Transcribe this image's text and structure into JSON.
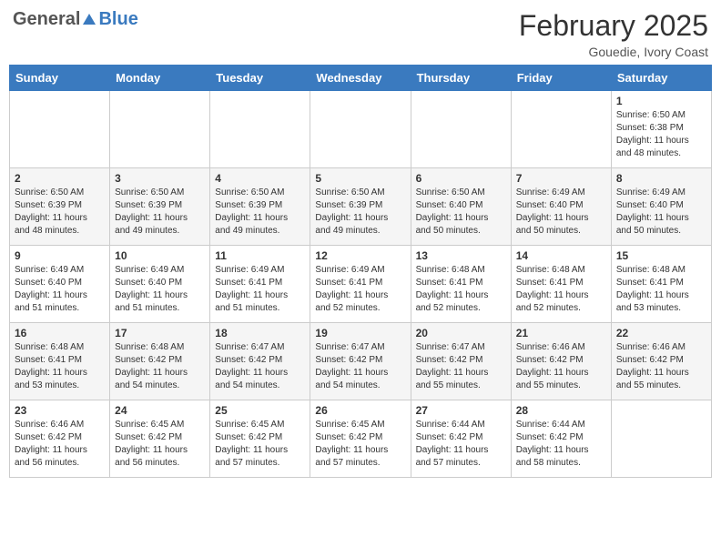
{
  "header": {
    "logo": {
      "text1": "General",
      "text2": "Blue"
    },
    "title": "February 2025",
    "subtitle": "Gouedie, Ivory Coast"
  },
  "days_of_week": [
    "Sunday",
    "Monday",
    "Tuesday",
    "Wednesday",
    "Thursday",
    "Friday",
    "Saturday"
  ],
  "weeks": [
    [
      {
        "day": "",
        "info": ""
      },
      {
        "day": "",
        "info": ""
      },
      {
        "day": "",
        "info": ""
      },
      {
        "day": "",
        "info": ""
      },
      {
        "day": "",
        "info": ""
      },
      {
        "day": "",
        "info": ""
      },
      {
        "day": "1",
        "info": "Sunrise: 6:50 AM\nSunset: 6:38 PM\nDaylight: 11 hours\nand 48 minutes."
      }
    ],
    [
      {
        "day": "2",
        "info": "Sunrise: 6:50 AM\nSunset: 6:39 PM\nDaylight: 11 hours\nand 48 minutes."
      },
      {
        "day": "3",
        "info": "Sunrise: 6:50 AM\nSunset: 6:39 PM\nDaylight: 11 hours\nand 49 minutes."
      },
      {
        "day": "4",
        "info": "Sunrise: 6:50 AM\nSunset: 6:39 PM\nDaylight: 11 hours\nand 49 minutes."
      },
      {
        "day": "5",
        "info": "Sunrise: 6:50 AM\nSunset: 6:39 PM\nDaylight: 11 hours\nand 49 minutes."
      },
      {
        "day": "6",
        "info": "Sunrise: 6:50 AM\nSunset: 6:40 PM\nDaylight: 11 hours\nand 50 minutes."
      },
      {
        "day": "7",
        "info": "Sunrise: 6:49 AM\nSunset: 6:40 PM\nDaylight: 11 hours\nand 50 minutes."
      },
      {
        "day": "8",
        "info": "Sunrise: 6:49 AM\nSunset: 6:40 PM\nDaylight: 11 hours\nand 50 minutes."
      }
    ],
    [
      {
        "day": "9",
        "info": "Sunrise: 6:49 AM\nSunset: 6:40 PM\nDaylight: 11 hours\nand 51 minutes."
      },
      {
        "day": "10",
        "info": "Sunrise: 6:49 AM\nSunset: 6:40 PM\nDaylight: 11 hours\nand 51 minutes."
      },
      {
        "day": "11",
        "info": "Sunrise: 6:49 AM\nSunset: 6:41 PM\nDaylight: 11 hours\nand 51 minutes."
      },
      {
        "day": "12",
        "info": "Sunrise: 6:49 AM\nSunset: 6:41 PM\nDaylight: 11 hours\nand 52 minutes."
      },
      {
        "day": "13",
        "info": "Sunrise: 6:48 AM\nSunset: 6:41 PM\nDaylight: 11 hours\nand 52 minutes."
      },
      {
        "day": "14",
        "info": "Sunrise: 6:48 AM\nSunset: 6:41 PM\nDaylight: 11 hours\nand 52 minutes."
      },
      {
        "day": "15",
        "info": "Sunrise: 6:48 AM\nSunset: 6:41 PM\nDaylight: 11 hours\nand 53 minutes."
      }
    ],
    [
      {
        "day": "16",
        "info": "Sunrise: 6:48 AM\nSunset: 6:41 PM\nDaylight: 11 hours\nand 53 minutes."
      },
      {
        "day": "17",
        "info": "Sunrise: 6:48 AM\nSunset: 6:42 PM\nDaylight: 11 hours\nand 54 minutes."
      },
      {
        "day": "18",
        "info": "Sunrise: 6:47 AM\nSunset: 6:42 PM\nDaylight: 11 hours\nand 54 minutes."
      },
      {
        "day": "19",
        "info": "Sunrise: 6:47 AM\nSunset: 6:42 PM\nDaylight: 11 hours\nand 54 minutes."
      },
      {
        "day": "20",
        "info": "Sunrise: 6:47 AM\nSunset: 6:42 PM\nDaylight: 11 hours\nand 55 minutes."
      },
      {
        "day": "21",
        "info": "Sunrise: 6:46 AM\nSunset: 6:42 PM\nDaylight: 11 hours\nand 55 minutes."
      },
      {
        "day": "22",
        "info": "Sunrise: 6:46 AM\nSunset: 6:42 PM\nDaylight: 11 hours\nand 55 minutes."
      }
    ],
    [
      {
        "day": "23",
        "info": "Sunrise: 6:46 AM\nSunset: 6:42 PM\nDaylight: 11 hours\nand 56 minutes."
      },
      {
        "day": "24",
        "info": "Sunrise: 6:45 AM\nSunset: 6:42 PM\nDaylight: 11 hours\nand 56 minutes."
      },
      {
        "day": "25",
        "info": "Sunrise: 6:45 AM\nSunset: 6:42 PM\nDaylight: 11 hours\nand 57 minutes."
      },
      {
        "day": "26",
        "info": "Sunrise: 6:45 AM\nSunset: 6:42 PM\nDaylight: 11 hours\nand 57 minutes."
      },
      {
        "day": "27",
        "info": "Sunrise: 6:44 AM\nSunset: 6:42 PM\nDaylight: 11 hours\nand 57 minutes."
      },
      {
        "day": "28",
        "info": "Sunrise: 6:44 AM\nSunset: 6:42 PM\nDaylight: 11 hours\nand 58 minutes."
      },
      {
        "day": "",
        "info": ""
      }
    ]
  ]
}
